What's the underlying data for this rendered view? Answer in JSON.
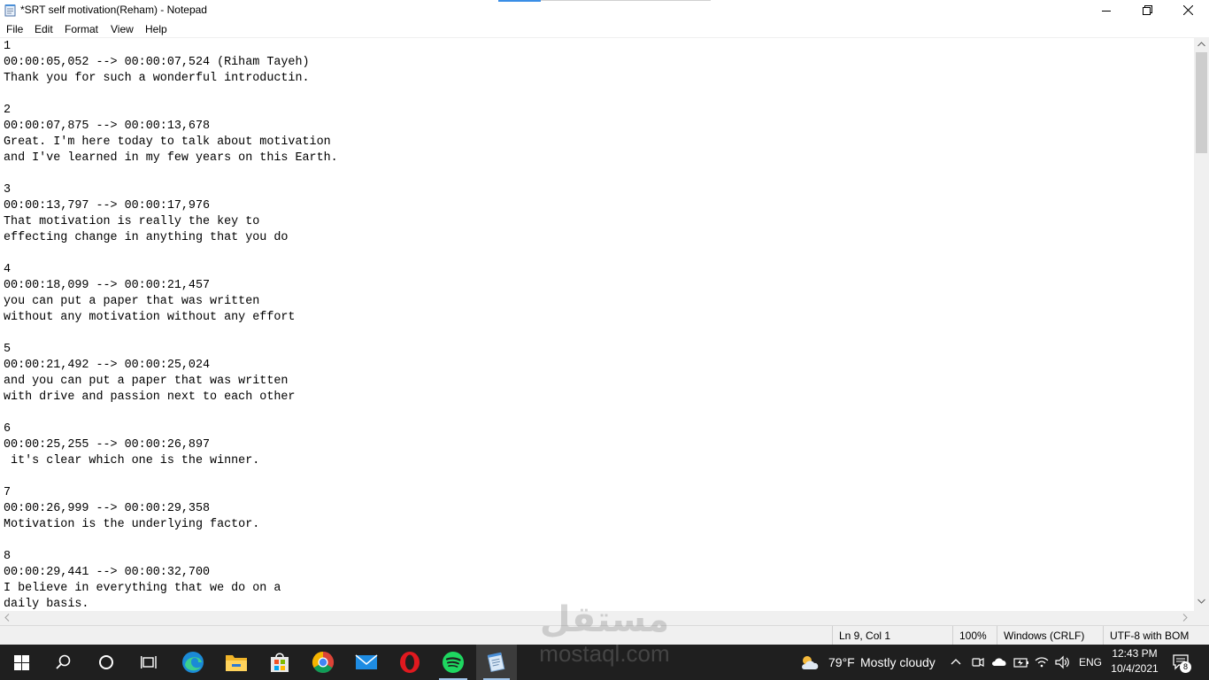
{
  "window": {
    "title": "*SRT self motivation(Reham) - Notepad",
    "controls": [
      "minimize",
      "maximize",
      "close"
    ]
  },
  "menu": {
    "items": [
      "File",
      "Edit",
      "Format",
      "View",
      "Help"
    ]
  },
  "editor": {
    "lines": [
      "1",
      "00:00:05,052 --> 00:00:07,524 (Riham Tayeh)",
      "Thank you for such a wonderful introductin.",
      "",
      "2",
      "00:00:07,875 --> 00:00:13,678",
      "Great. I'm here today to talk about motivation",
      "and I've learned in my few years on this Earth.",
      "",
      "3",
      "00:00:13,797 --> 00:00:17,976",
      "That motivation is really the key to",
      "effecting change in anything that you do",
      "",
      "4",
      "00:00:18,099 --> 00:00:21,457",
      "you can put a paper that was written",
      "without any motivation without any effort",
      "",
      "5",
      "00:00:21,492 --> 00:00:25,024",
      "and you can put a paper that was written",
      "with drive and passion next to each other",
      "",
      "6",
      "00:00:25,255 --> 00:00:26,897",
      " it's clear which one is the winner.",
      "",
      "7",
      "00:00:26,999 --> 00:00:29,358",
      "Motivation is the underlying factor.",
      "",
      "8",
      "00:00:29,441 --> 00:00:32,700",
      "I believe in everything that we do on a",
      "daily basis."
    ]
  },
  "statusbar": {
    "position": "Ln 9, Col 1",
    "zoom": "100%",
    "line_ending": "Windows (CRLF)",
    "encoding": "UTF-8 with BOM"
  },
  "taskbar": {
    "apps": [
      "start-icon",
      "search-icon",
      "cortana-icon",
      "task-view-icon",
      "edge-icon",
      "file-explorer-icon",
      "store-icon",
      "chrome-icon",
      "mail-icon",
      "opera-icon",
      "spotify-icon",
      "notepad-icon"
    ],
    "weather_temp": "79°F",
    "weather_text": "Mostly cloudy",
    "language": "ENG",
    "time": "12:43 PM",
    "date": "10/4/2021",
    "notification_count": "8"
  },
  "watermark": {
    "arabic": "مستقل",
    "latin": "mostaql.com"
  },
  "colors": {
    "taskbar_bg": "#1f1f1f",
    "accent": "#3a8ee6",
    "status_bg": "#f0f0f0"
  }
}
